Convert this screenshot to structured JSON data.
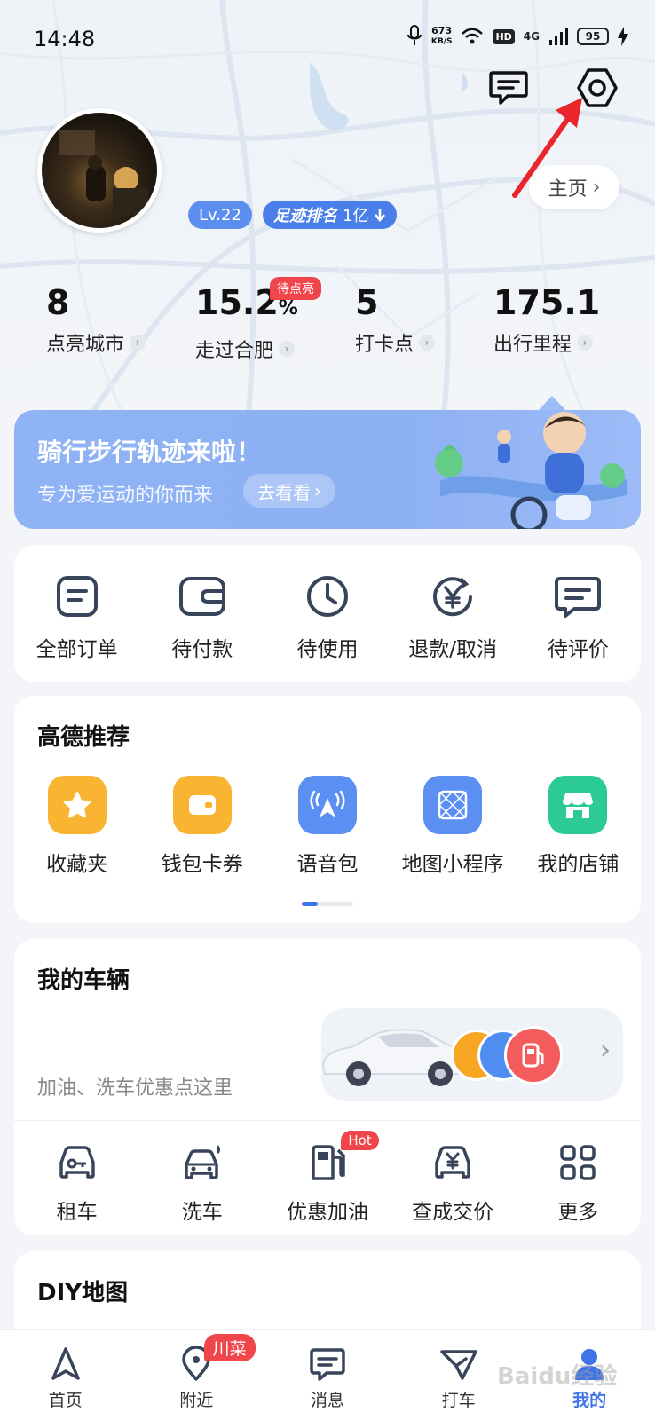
{
  "status_bar": {
    "time": "14:48",
    "net_speed_value": "673",
    "net_speed_unit": "KB/S",
    "hd": "HD",
    "signal": "4G",
    "battery": "95"
  },
  "header": {
    "homepage_label": "主页",
    "level": "Lv.22",
    "rank_label": "足迹排名",
    "rank_value": "1亿"
  },
  "stats": [
    {
      "value": "8",
      "unit": "",
      "label": "点亮城市"
    },
    {
      "value": "15.2",
      "unit": "%",
      "label": "走过合肥"
    },
    {
      "value": "5",
      "unit": "",
      "label": "打卡点"
    },
    {
      "value": "175.1",
      "unit": "",
      "label": "出行里程"
    }
  ],
  "pending_badge": "待点亮",
  "banner": {
    "title": "骑行步行轨迹来啦！",
    "subtitle": "专为爱运动的你而来",
    "button": "去看看"
  },
  "orders": [
    {
      "label": "全部订单",
      "icon": "order-list-icon"
    },
    {
      "label": "待付款",
      "icon": "wallet-icon"
    },
    {
      "label": "待使用",
      "icon": "clock-icon"
    },
    {
      "label": "退款/取消",
      "icon": "refund-icon"
    },
    {
      "label": "待评价",
      "icon": "review-icon"
    }
  ],
  "recommend": {
    "title": "高德推荐",
    "items": [
      {
        "label": "收藏夹",
        "icon": "star-icon",
        "color": "#f9b531"
      },
      {
        "label": "钱包卡券",
        "icon": "wallet-card-icon",
        "color": "#f9b531"
      },
      {
        "label": "语音包",
        "icon": "voice-pack-icon",
        "color": "#5b8ff2"
      },
      {
        "label": "地图小程序",
        "icon": "mini-program-icon",
        "color": "#5b8ff2"
      },
      {
        "label": "我的店铺",
        "icon": "shop-icon",
        "color": "#2ccb96"
      }
    ]
  },
  "vehicle": {
    "title": "我的车辆",
    "hint": "加油、洗车优惠点这里",
    "services": [
      {
        "label": "租车",
        "icon": "rent-car-icon"
      },
      {
        "label": "洗车",
        "icon": "car-wash-icon"
      },
      {
        "label": "优惠加油",
        "icon": "fuel-icon",
        "badge": "Hot"
      },
      {
        "label": "查成交价",
        "icon": "price-check-icon"
      },
      {
        "label": "更多",
        "icon": "grid-more-icon"
      }
    ]
  },
  "diy": {
    "title": "DIY地图"
  },
  "tabbar": [
    {
      "label": "首页",
      "icon": "navigate-icon"
    },
    {
      "label": "附近",
      "icon": "location-pin-icon",
      "badge": "川菜"
    },
    {
      "label": "消息",
      "icon": "message-icon"
    },
    {
      "label": "打车",
      "icon": "taxi-icon"
    },
    {
      "label": "我的",
      "icon": "profile-icon",
      "active": true
    }
  ],
  "watermark": "Baidu经验",
  "colors": {
    "accent": "#3f74e8",
    "badge_red": "#f0454b",
    "banner": "#8fb3f5"
  }
}
